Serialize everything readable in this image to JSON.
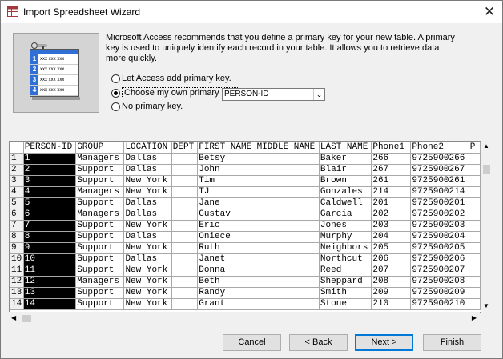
{
  "window": {
    "title": "Import Spreadsheet Wizard",
    "close_glyph": "✕"
  },
  "intro_text": "Microsoft Access recommends that you define a primary key for your new table. A primary key is used to uniquely identify each record in your table. It allows you to retrieve data more quickly.",
  "illustration": {
    "rows": [
      "1",
      "2",
      "3",
      "4"
    ],
    "cell_text": "xxx xxx xxx"
  },
  "options": {
    "add_key": "Let Access add primary key.",
    "own_key": "Choose my own primary key.",
    "no_key": "No primary key.",
    "selected": "own_key"
  },
  "key_field": {
    "value": "PERSON-ID"
  },
  "table": {
    "columns": [
      "PERSON-ID",
      "GROUP",
      "LOCATION",
      "DEPT",
      "FIRST NAME",
      "MIDDLE NAME",
      "LAST NAME",
      "Phone1",
      "Phone2",
      "P"
    ],
    "rows": [
      [
        "1",
        "1",
        "Managers",
        "Dallas",
        "",
        "Betsy",
        "",
        "Baker",
        "266",
        "9725900266"
      ],
      [
        "2",
        "2",
        "Support",
        "Dallas",
        "",
        "John",
        "",
        "Blair",
        "267",
        "9725900267"
      ],
      [
        "3",
        "3",
        "Support",
        "New York",
        "",
        "Tim",
        "",
        "Brown",
        "261",
        "9725900261"
      ],
      [
        "4",
        "4",
        "Managers",
        "New York",
        "",
        "TJ",
        "",
        "Gonzales",
        "214",
        "9725900214"
      ],
      [
        "5",
        "5",
        "Support",
        "Dallas",
        "",
        "Jane",
        "",
        "Caldwell",
        "201",
        "9725900201"
      ],
      [
        "6",
        "6",
        "Managers",
        "Dallas",
        "",
        "Gustav",
        "",
        "Garcia",
        "202",
        "9725900202"
      ],
      [
        "7",
        "7",
        "Support",
        "New York",
        "",
        "Eric",
        "",
        "Jones",
        "203",
        "9725900203"
      ],
      [
        "8",
        "8",
        "Support",
        "Dallas",
        "",
        "Oniece",
        "",
        "Murphy",
        "204",
        "9725900204"
      ],
      [
        "9",
        "9",
        "Support",
        "New York",
        "",
        "Ruth",
        "",
        "Neighbors",
        "205",
        "9725900205"
      ],
      [
        "10",
        "10",
        "Support",
        "Dallas",
        "",
        "Janet",
        "",
        "Northcut",
        "206",
        "9725900206"
      ],
      [
        "11",
        "11",
        "Support",
        "New York",
        "",
        "Donna",
        "",
        "Reed",
        "207",
        "9725900207"
      ],
      [
        "12",
        "12",
        "Managers",
        "New York",
        "",
        "Beth",
        "",
        "Sheppard",
        "208",
        "9725900208"
      ],
      [
        "13",
        "13",
        "Support",
        "New York",
        "",
        "Randy",
        "",
        "Smith",
        "209",
        "9725900209"
      ],
      [
        "14",
        "14",
        "Support",
        "New York",
        "",
        "Grant",
        "",
        "Stone",
        "210",
        "9725900210"
      ]
    ]
  },
  "buttons": {
    "cancel": "Cancel",
    "back": "< Back",
    "next": "Next >",
    "finish": "Finish"
  },
  "colors": {
    "selected_column": "#000000",
    "default_button_border": "#0078d7",
    "illustration_blue": "#2f6fd6"
  }
}
